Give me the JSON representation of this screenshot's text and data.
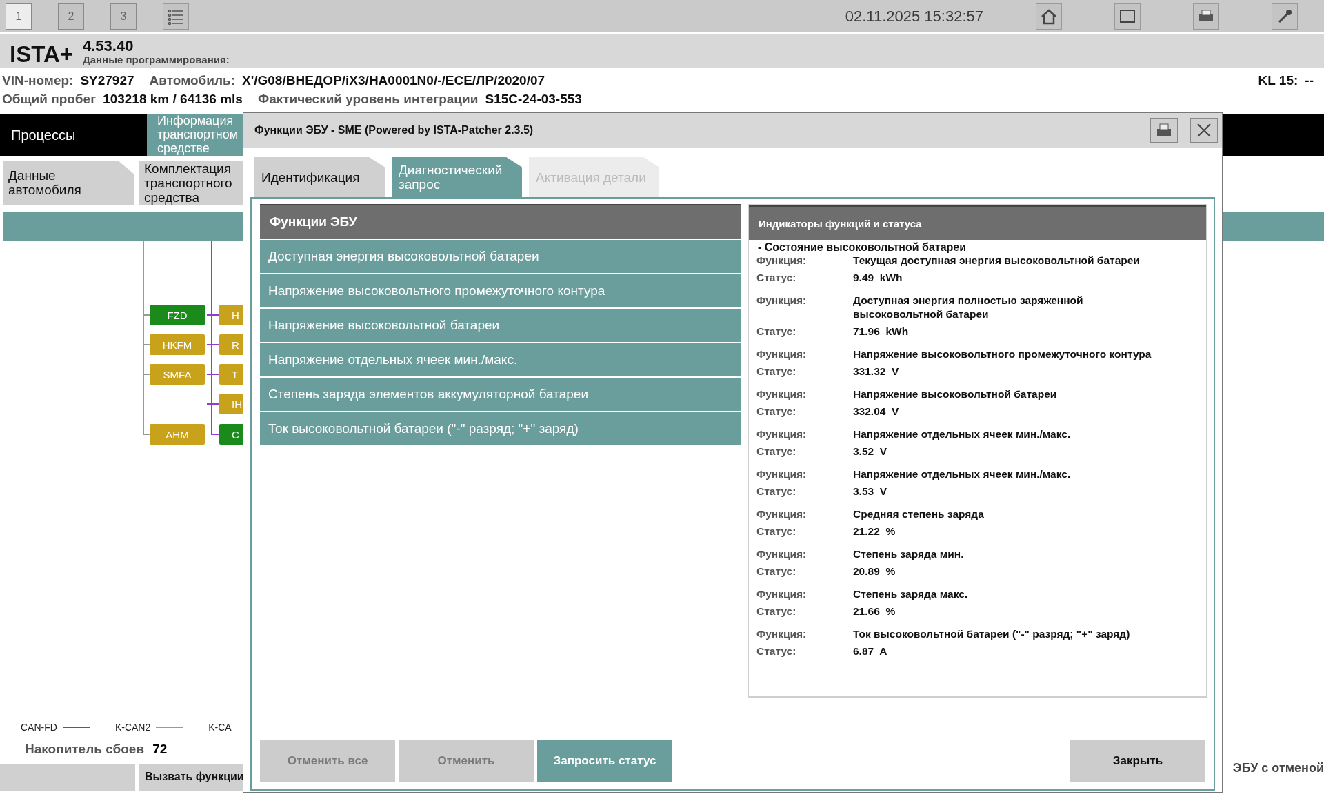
{
  "toolbar": {
    "buttons": [
      {
        "label": "1",
        "selected": true
      },
      {
        "label": "2",
        "selected": false
      },
      {
        "label": "3",
        "selected": false
      }
    ],
    "datetime": "02.11.2025 15:32:57"
  },
  "app": {
    "name": "ISTA+",
    "version": "4.53.40",
    "subtitle": "Данные программирования:"
  },
  "vehicle": {
    "vin_label": "VIN-номер:",
    "vin": "SY27927",
    "car_label": "Автомобиль:",
    "car": "X'/G08/ВНЕДОР/iX3/HA0001N0/-/ECE/ЛР/2020/07",
    "kl_label": "KL 15:",
    "kl": "--",
    "mileage_label": "Общий пробег",
    "mileage": "103218 km / 64136 mls",
    "level_label": "Фактический уровень интеграции",
    "level": "S15C-24-03-553"
  },
  "main_tabs": [
    {
      "label": "Процессы",
      "selected": false
    },
    {
      "lines": [
        "Информация",
        "транспортном",
        "средстве"
      ],
      "selected": true
    }
  ],
  "sub_tabs": [
    {
      "label": "Данные автомобиля",
      "selected": false
    },
    {
      "label": "Комплектация транспортного средства",
      "selected": false
    }
  ],
  "diagram": {
    "columns": [
      [
        {
          "kind": "node",
          "label": "FZD",
          "color": "#1a8a1a"
        },
        {
          "kind": "node",
          "label": "HKFM",
          "color": "#c9a21c"
        },
        {
          "kind": "node",
          "label": "SMFA",
          "color": "#c9a21c"
        },
        {
          "kind": "empty"
        },
        {
          "kind": "node",
          "label": "AHM",
          "color": "#c9a21c"
        }
      ],
      [
        {
          "kind": "node",
          "label": "H",
          "color": "#c9a21c"
        },
        {
          "kind": "node",
          "label": "R",
          "color": "#c9a21c"
        },
        {
          "kind": "node",
          "label": "T",
          "color": "#c9a21c"
        },
        {
          "kind": "node",
          "label": "IH",
          "color": "#c9a21c"
        },
        {
          "kind": "node",
          "label": "C",
          "color": "#1a8a1a"
        }
      ]
    ]
  },
  "legend": [
    {
      "label": "CAN-FD",
      "color": "#1a8a1a"
    },
    {
      "label": "K-CAN2",
      "color": "#999999"
    },
    {
      "label": "K-CA"
    }
  ],
  "fault_memory": {
    "label": "Накопитель сбоев",
    "count": "72"
  },
  "bottom_buttons": [
    {
      "kind": "blank"
    },
    {
      "kind": "text",
      "label": "Вызвать функции"
    }
  ],
  "side_note": "ЭБУ с отменой",
  "dialog": {
    "title": "Функции ЭБУ - SME (Powered by ISTA-Patcher 2.3.5)",
    "tabs": [
      {
        "label": "Идентификация",
        "selected": false,
        "disabled": false
      },
      {
        "label": "Диагностический запрос",
        "selected": true,
        "disabled": false
      },
      {
        "label": "Активация детали",
        "selected": false,
        "disabled": true
      }
    ],
    "list_header": "Функции ЭБУ",
    "functions": [
      "Доступная энергия высоковольтной батареи",
      "Напряжение высоковольтного промежуточного контура",
      "Напряжение высоковольтной батареи",
      "Напряжение отдельных ячеек мин./макс.",
      "Степень заряда элементов аккумуляторной батареи",
      "Ток высоковольтной батареи (\"-\" разряд; \"+\" заряд)"
    ],
    "status_panel": {
      "title": "Индикаторы функций и статуса",
      "section": "- Состояние высоковольтной батареи",
      "entries": [
        {
          "function_label": "Функция:",
          "function": "Текущая доступная энергия высоковольтной батареи",
          "status_label": "Статус:",
          "status": "9.49  kWh"
        },
        {
          "function_label": "Функция:",
          "function": "Доступная энергия полностью заряженной высоковольтной батареи",
          "status_label": "Статус:",
          "status": "71.96  kWh"
        },
        {
          "function_label": "Функция:",
          "function": "Напряжение высоковольтного промежуточного контура",
          "status_label": "Статус:",
          "status": "331.32  V"
        },
        {
          "function_label": "Функция:",
          "function": "Напряжение высоковольтной батареи",
          "status_label": "Статус:",
          "status": "332.04  V"
        },
        {
          "function_label": "Функция:",
          "function": "Напряжение отдельных ячеек мин./макс.",
          "status_label": "Статус:",
          "status": "3.52  V"
        },
        {
          "function_label": "Функция:",
          "function": "Напряжение отдельных ячеек мин./макс.",
          "status_label": "Статус:",
          "status": "3.53  V"
        },
        {
          "function_label": "Функция:",
          "function": "Средняя степень заряда",
          "status_label": "Статус:",
          "status": "21.22  %"
        },
        {
          "function_label": "Функция:",
          "function": "Степень заряда мин.",
          "status_label": "Статус:",
          "status": "20.89  %"
        },
        {
          "function_label": "Функция:",
          "function": "Степень заряда макс.",
          "status_label": "Статус:",
          "status": "21.66  %"
        },
        {
          "function_label": "Функция:",
          "function": "Ток высоковольтной батареи (\"-\" разряд; \"+\" заряд)",
          "status_label": "Статус:",
          "status": "6.87  A"
        }
      ]
    },
    "buttons": [
      {
        "label": "Отменить все",
        "kind": "disabled"
      },
      {
        "label": "Отменить",
        "kind": "disabled"
      },
      {
        "label": "Запросить статус",
        "kind": "primary"
      },
      {
        "label": "Закрыть",
        "kind": "normal"
      }
    ]
  }
}
